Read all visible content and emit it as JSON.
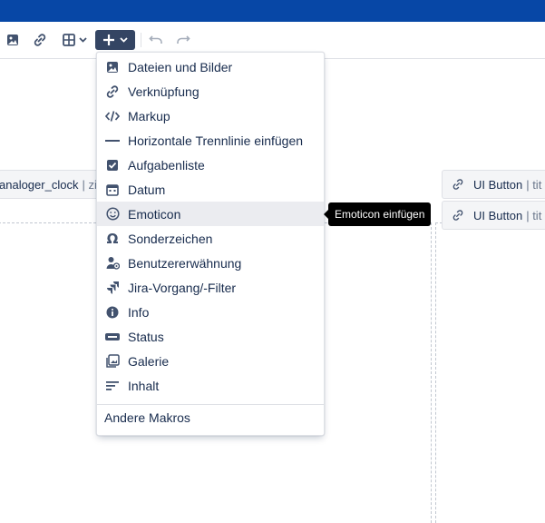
{
  "toolbar": {
    "buttons": [
      "image-icon",
      "link-icon",
      "table-icon",
      "insert-plus-icon",
      "undo-icon",
      "redo-icon"
    ]
  },
  "canvas": {
    "macro_left": {
      "title": "analoger_clock",
      "sub": "| zif"
    },
    "macro_right_1": {
      "title": "UI Button",
      "sub": "| tit"
    },
    "macro_right_2": {
      "title": "UI Button",
      "sub": "| tit"
    }
  },
  "insert_menu": {
    "items": [
      {
        "label": "Dateien und Bilder",
        "icon": "image-icon"
      },
      {
        "label": "Verknüpfung",
        "icon": "link-icon"
      },
      {
        "label": "Markup",
        "icon": "code-icon"
      },
      {
        "label": "Horizontale Trennlinie einfügen",
        "icon": "horizontal-rule-icon"
      },
      {
        "label": "Aufgabenliste",
        "icon": "checkbox-icon"
      },
      {
        "label": "Datum",
        "icon": "calendar-icon"
      },
      {
        "label": "Emoticon",
        "icon": "emoji-icon",
        "hovered": true
      },
      {
        "label": "Sonderzeichen",
        "icon": "omega-icon"
      },
      {
        "label": "Benutzererwähnung",
        "icon": "user-mention-icon"
      },
      {
        "label": "Jira-Vorgang/-Filter",
        "icon": "jira-icon"
      },
      {
        "label": "Info",
        "icon": "info-icon"
      },
      {
        "label": "Status",
        "icon": "status-icon"
      },
      {
        "label": "Galerie",
        "icon": "gallery-icon"
      },
      {
        "label": "Inhalt",
        "icon": "toc-icon"
      }
    ],
    "other_macros": "Andere Makros"
  },
  "tooltip": "Emoticon einfügen",
  "colors": {
    "topbar": "#0747a6",
    "plus_button": "#344563",
    "hover": "#ebecf0"
  }
}
